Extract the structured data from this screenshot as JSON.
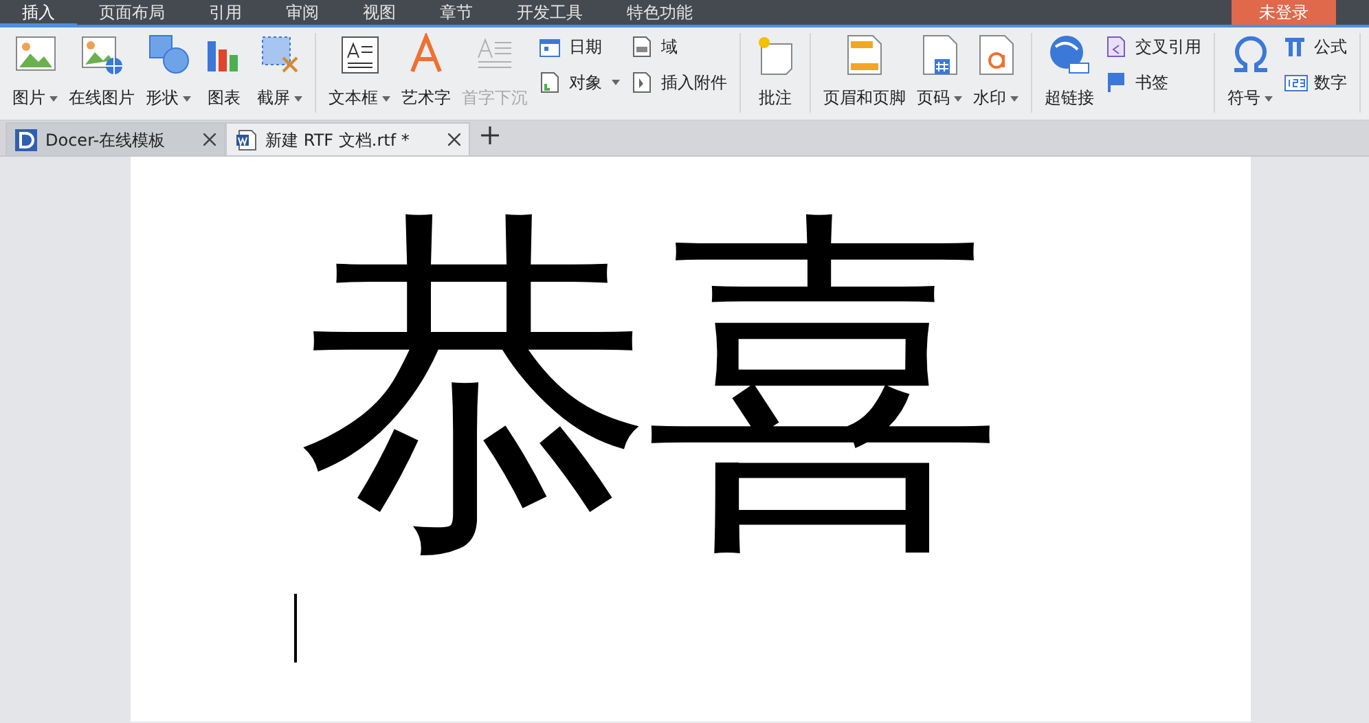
{
  "menu_tabs": [
    {
      "label": "插入",
      "selected": true
    },
    {
      "label": "页面布局",
      "selected": false
    },
    {
      "label": "引用",
      "selected": false
    },
    {
      "label": "审阅",
      "selected": false
    },
    {
      "label": "视图",
      "selected": false
    },
    {
      "label": "章节",
      "selected": false
    },
    {
      "label": "开发工具",
      "selected": false
    },
    {
      "label": "特色功能",
      "selected": false
    }
  ],
  "login_button": "未登录",
  "ribbon_groups": [
    {
      "items": [
        {
          "kind": "large",
          "label": "图片",
          "dropdown": true,
          "disabled": false
        },
        {
          "kind": "large",
          "label": "在线图片",
          "dropdown": false,
          "disabled": false
        },
        {
          "kind": "large",
          "label": "形状",
          "dropdown": true,
          "disabled": false
        },
        {
          "kind": "large",
          "label": "图表",
          "dropdown": false,
          "disabled": false
        },
        {
          "kind": "large",
          "label": "截屏",
          "dropdown": true,
          "disabled": false
        }
      ]
    },
    {
      "items": [
        {
          "kind": "large",
          "label": "文本框",
          "dropdown": true,
          "disabled": false
        },
        {
          "kind": "large",
          "label": "艺术字",
          "dropdown": false,
          "disabled": false
        },
        {
          "kind": "large",
          "label": "首字下沉",
          "dropdown": false,
          "disabled": true
        },
        {
          "kind": "stack",
          "items": [
            {
              "label": "日期",
              "dropdown": false
            },
            {
              "label": "对象",
              "dropdown": true
            }
          ]
        },
        {
          "kind": "stack",
          "items": [
            {
              "label": "域",
              "dropdown": false
            },
            {
              "label": "插入附件",
              "dropdown": false
            }
          ]
        }
      ]
    },
    {
      "items": [
        {
          "kind": "large",
          "label": "批注",
          "dropdown": false,
          "disabled": false
        }
      ]
    },
    {
      "items": [
        {
          "kind": "large",
          "label": "页眉和页脚",
          "dropdown": false,
          "disabled": false
        },
        {
          "kind": "large",
          "label": "页码",
          "dropdown": true,
          "disabled": false
        },
        {
          "kind": "large",
          "label": "水印",
          "dropdown": true,
          "disabled": false
        }
      ]
    },
    {
      "items": [
        {
          "kind": "large",
          "label": "超链接",
          "dropdown": false,
          "disabled": false
        },
        {
          "kind": "stack",
          "items": [
            {
              "label": "交叉引用",
              "dropdown": false
            },
            {
              "label": "书签",
              "dropdown": false
            }
          ]
        }
      ]
    },
    {
      "items": [
        {
          "kind": "large",
          "label": "符号",
          "dropdown": true,
          "disabled": false
        },
        {
          "kind": "stack",
          "items": [
            {
              "label": "公式",
              "dropdown": false
            },
            {
              "label": "数字",
              "dropdown": false
            }
          ]
        }
      ]
    }
  ],
  "doc_tabs": [
    {
      "kind": "docer",
      "label": "Docer-在线模板",
      "selected": false
    },
    {
      "kind": "document",
      "label": "新建 RTF 文档.rtf *",
      "selected": true
    }
  ],
  "document": {
    "text": "恭喜"
  }
}
